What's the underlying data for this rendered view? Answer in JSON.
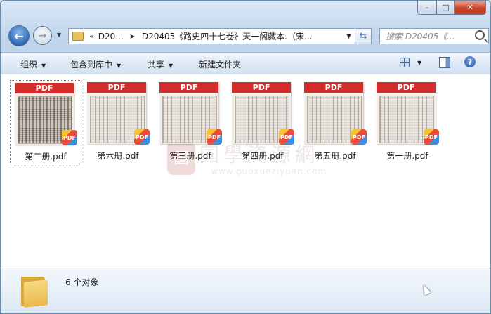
{
  "window": {
    "caption_buttons": {
      "minimize": "–",
      "maximize": "□",
      "close": "✕"
    }
  },
  "nav": {
    "back_glyph": "←",
    "forward_glyph": "→",
    "address_overflow": "«",
    "address_segments": [
      "D20...",
      "D20405《路史四十七卷》天一阁藏本.（宋..."
    ],
    "search_placeholder": "搜索 D20405《..."
  },
  "toolbar": {
    "organize": "组织",
    "include_in_library": "包含到库中",
    "share": "共享",
    "new_folder": "新建文件夹",
    "help": "?"
  },
  "files": [
    {
      "name": "第二册.pdf",
      "band": "PDF",
      "badge": "PDF",
      "selected": true
    },
    {
      "name": "第六册.pdf",
      "band": "PDF",
      "badge": "PDF",
      "selected": false
    },
    {
      "name": "第三册.pdf",
      "band": "PDF",
      "badge": "PDF",
      "selected": false
    },
    {
      "name": "第四册.pdf",
      "band": "PDF",
      "badge": "PDF",
      "selected": false
    },
    {
      "name": "第五册.pdf",
      "band": "PDF",
      "badge": "PDF",
      "selected": false
    },
    {
      "name": "第一册.pdf",
      "band": "PDF",
      "badge": "PDF",
      "selected": false
    }
  ],
  "watermark": {
    "seal": "国",
    "text": "国學資源網",
    "url": "www.guoxueziyuan.com"
  },
  "status": {
    "item_count": "6 个对象"
  },
  "colors": {
    "pdf_band": "#d62b2b",
    "window_frame": "#c5d9ee",
    "close_button": "#c7381e"
  }
}
